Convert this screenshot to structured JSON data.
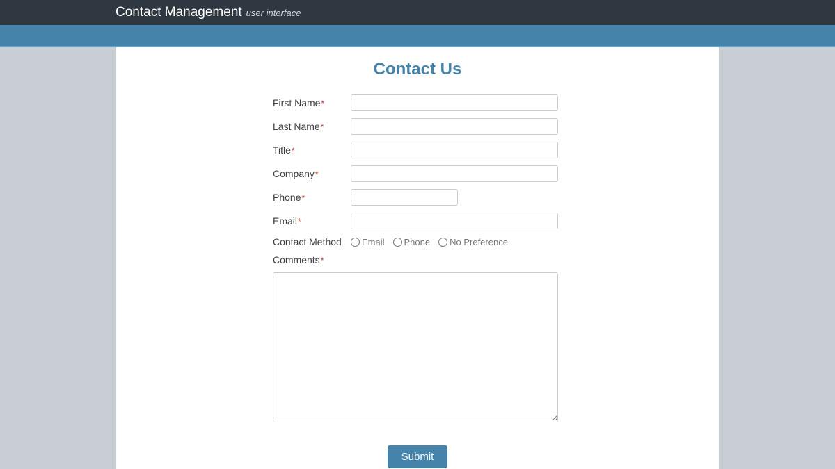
{
  "header": {
    "title": "Contact Management",
    "subtitle": "user interface"
  },
  "form": {
    "heading": "Contact Us",
    "fields": {
      "first_name": {
        "label": "First Name",
        "value": ""
      },
      "last_name": {
        "label": "Last Name",
        "value": ""
      },
      "title": {
        "label": "Title",
        "value": ""
      },
      "company": {
        "label": "Company",
        "value": ""
      },
      "phone": {
        "label": "Phone",
        "value": ""
      },
      "email": {
        "label": "Email",
        "value": ""
      },
      "contact_method": {
        "label": "Contact Method",
        "options": {
          "email": "Email",
          "phone": "Phone",
          "none": "No Preference"
        }
      },
      "comments": {
        "label": "Comments",
        "value": ""
      }
    },
    "submit_label": "Submit"
  }
}
